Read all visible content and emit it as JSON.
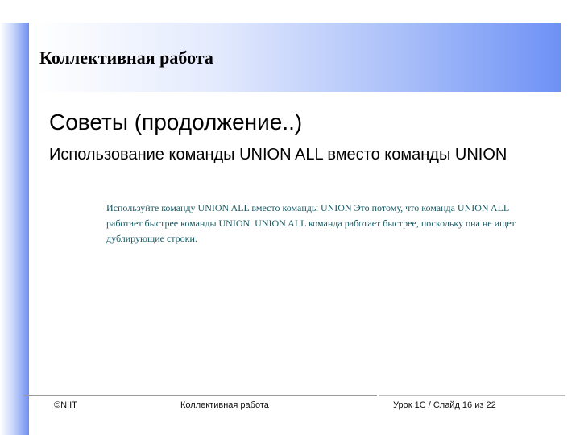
{
  "slide": {
    "title": "Коллективная работа",
    "subtitle": "Советы (продолжение..)",
    "body": "Использование команды UNION ALL вместо команды UNION",
    "note": "Используйте команду UNION ALL вместо команды UNION Это потому, что команда UNION ALL работает быстрее команды UNION. UNION ALL команда работает быстрее, поскольку она не ищет дублирующие строки."
  },
  "footer": {
    "copyright": "©NIIT",
    "topic": "Коллективная работа",
    "page": "Урок 1C / Слайд 16 из 22"
  }
}
